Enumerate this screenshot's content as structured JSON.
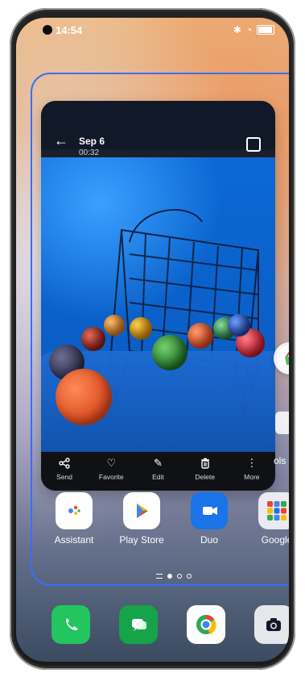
{
  "status_bar": {
    "time": "14:54",
    "icons": [
      "bluetooth-icon",
      "wifi-icon",
      "battery-icon"
    ]
  },
  "recent_card": {
    "title": "Sep 6",
    "subtitle": "00:32",
    "actions": [
      {
        "label": "Send",
        "icon": "share-icon"
      },
      {
        "label": "Favorite",
        "icon": "heart-icon"
      },
      {
        "label": "Edit",
        "icon": "pencil-icon"
      },
      {
        "label": "Delete",
        "icon": "trash-icon"
      },
      {
        "label": "More",
        "icon": "more-vertical-icon"
      }
    ]
  },
  "home": {
    "edge_label": "ols",
    "apps": [
      {
        "label": "Assistant",
        "icon": "assistant-icon"
      },
      {
        "label": "Play Store",
        "icon": "play-store-icon"
      },
      {
        "label": "Duo",
        "icon": "duo-icon"
      },
      {
        "label": "Google",
        "icon": "google-folder-icon"
      }
    ],
    "dock": [
      {
        "label": "Phone",
        "icon": "phone-icon"
      },
      {
        "label": "Messages",
        "icon": "messages-icon"
      },
      {
        "label": "Chrome",
        "icon": "chrome-icon"
      },
      {
        "label": "Camera",
        "icon": "camera-icon"
      }
    ]
  },
  "colors": {
    "selection_outline": "#3b6dff"
  }
}
